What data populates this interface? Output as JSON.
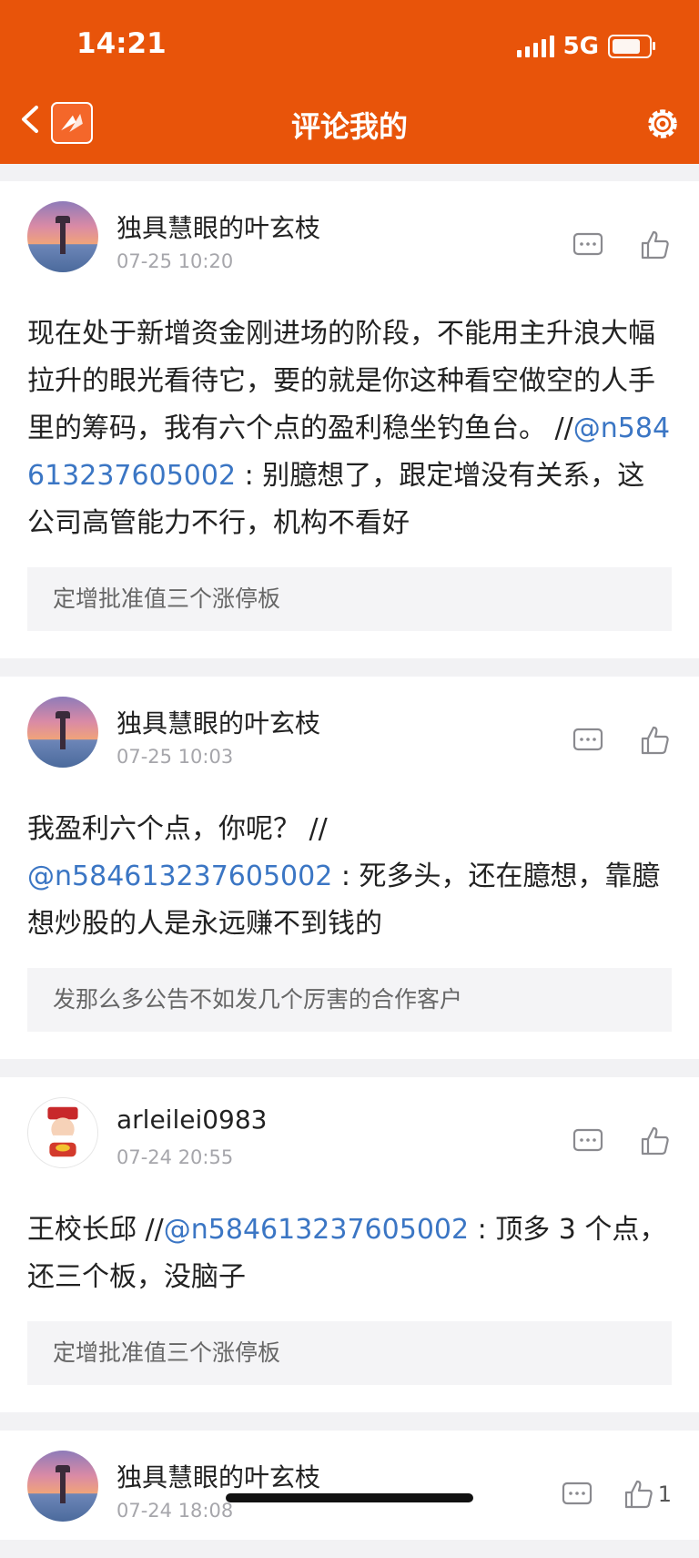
{
  "status_bar": {
    "time": "14:21",
    "network": "5G"
  },
  "nav": {
    "title": "评论我的"
  },
  "comments": [
    {
      "user": "独具慧眼的叶玄枝",
      "time": "07-25 10:20",
      "avatar": "sunset-lighthouse",
      "text_before": "现在处于新增资金刚进场的阶段，不能用主升浪大幅拉升的眼光看待它，要的就是你这种看空做空的人手里的筹码，我有六个点的盈利稳坐钓鱼台。 //",
      "mention": "@n584613237605002",
      "text_after": " : 别臆想了，跟定增没有关系，这公司高管能力不行，机构不看好",
      "quote": "定增批准值三个涨停板"
    },
    {
      "user": "独具慧眼的叶玄枝",
      "time": "07-25 10:03",
      "avatar": "sunset-lighthouse",
      "text_before": "我盈利六个点，你呢？ //",
      "mention": "@n584613237605002",
      "text_after": " : 死多头，还在臆想，靠臆想炒股的人是永远赚不到钱的",
      "quote": "发那么多公告不如发几个厉害的合作客户"
    },
    {
      "user": "arleilei0983",
      "time": "07-24 20:55",
      "avatar": "fortune-god",
      "text_before": "王校长邱 //",
      "mention": "@n584613237605002",
      "text_after": " : 顶多 3 个点，还三个板，没脑子",
      "quote": "定增批准值三个涨停板"
    },
    {
      "user": "独具慧眼的叶玄枝",
      "time": "07-24 18:08",
      "avatar": "sunset-lighthouse",
      "like_count": "1"
    }
  ]
}
